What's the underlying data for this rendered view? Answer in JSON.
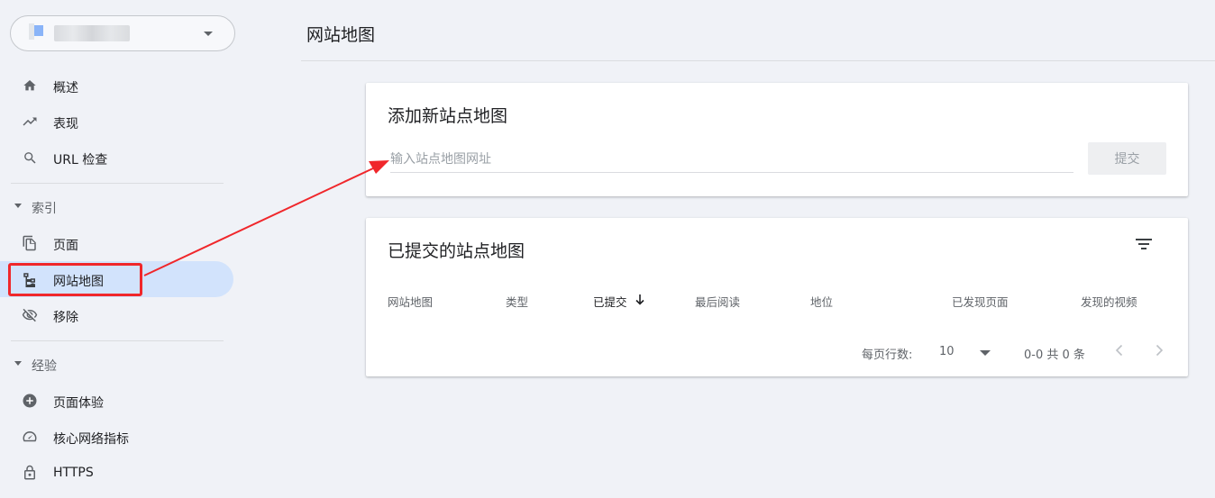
{
  "sidebar": {
    "property_selector": {
      "caret_icon": "caret-down-icon"
    },
    "items": [
      {
        "label": "概述",
        "icon": "home-icon"
      },
      {
        "label": "表现",
        "icon": "trending-up-icon"
      },
      {
        "label": "URL 检查",
        "icon": "search-icon"
      }
    ],
    "sections": [
      {
        "label": "索引",
        "items": [
          {
            "label": "页面",
            "icon": "copy-pages-icon"
          },
          {
            "label": "网站地图",
            "icon": "sitemap-icon",
            "active": true
          },
          {
            "label": "移除",
            "icon": "eye-off-icon"
          }
        ]
      },
      {
        "label": "经验",
        "items": [
          {
            "label": "页面体验",
            "icon": "plus-circle-icon"
          },
          {
            "label": "核心网络指标",
            "icon": "speedometer-icon"
          },
          {
            "label": "HTTPS",
            "icon": "lock-icon"
          }
        ]
      }
    ]
  },
  "main": {
    "title": "网站地图",
    "add_card": {
      "title": "添加新站点地图",
      "input_placeholder": "输入站点地图网址",
      "input_value": "",
      "submit_label": "提交"
    },
    "submitted_card": {
      "title": "已提交的站点地图",
      "filter_icon": "filter-icon",
      "columns": [
        "网站地图",
        "类型",
        "已提交",
        "最后阅读",
        "地位",
        "已发现页面",
        "发现的视频"
      ],
      "sorted_column": "已提交",
      "sort_icon": "arrow-down-icon",
      "rows": [],
      "pagination": {
        "rows_per_page_label": "每页行数:",
        "rows_per_page": "10",
        "range_text": "0-0 共 0 条"
      }
    }
  },
  "annotation": {
    "color": "#f0272b"
  },
  "colors": {
    "accent_active": "#d2e3fc",
    "background": "#f0f2f7"
  }
}
